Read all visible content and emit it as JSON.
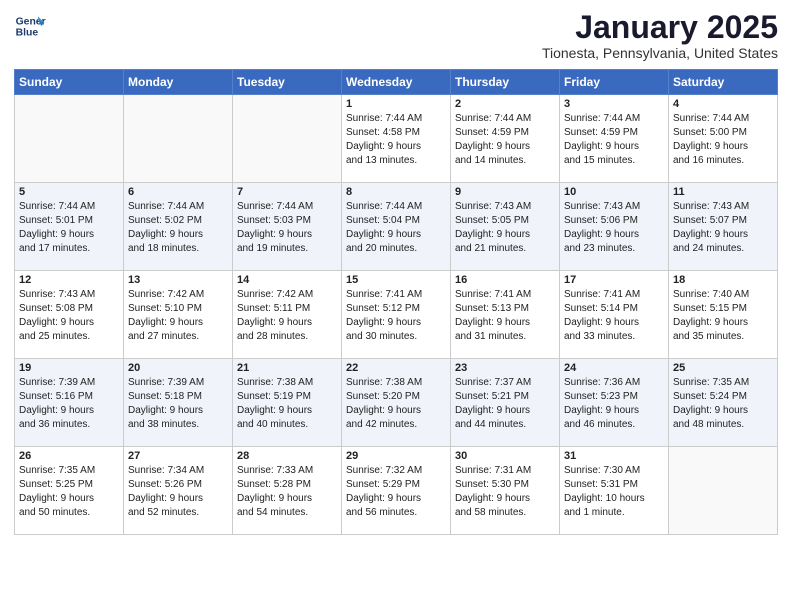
{
  "header": {
    "logo_line1": "General",
    "logo_line2": "Blue",
    "month": "January 2025",
    "location": "Tionesta, Pennsylvania, United States"
  },
  "days_of_week": [
    "Sunday",
    "Monday",
    "Tuesday",
    "Wednesday",
    "Thursday",
    "Friday",
    "Saturday"
  ],
  "weeks": [
    [
      {
        "day": "",
        "info": ""
      },
      {
        "day": "",
        "info": ""
      },
      {
        "day": "",
        "info": ""
      },
      {
        "day": "1",
        "info": "Sunrise: 7:44 AM\nSunset: 4:58 PM\nDaylight: 9 hours\nand 13 minutes."
      },
      {
        "day": "2",
        "info": "Sunrise: 7:44 AM\nSunset: 4:59 PM\nDaylight: 9 hours\nand 14 minutes."
      },
      {
        "day": "3",
        "info": "Sunrise: 7:44 AM\nSunset: 4:59 PM\nDaylight: 9 hours\nand 15 minutes."
      },
      {
        "day": "4",
        "info": "Sunrise: 7:44 AM\nSunset: 5:00 PM\nDaylight: 9 hours\nand 16 minutes."
      }
    ],
    [
      {
        "day": "5",
        "info": "Sunrise: 7:44 AM\nSunset: 5:01 PM\nDaylight: 9 hours\nand 17 minutes."
      },
      {
        "day": "6",
        "info": "Sunrise: 7:44 AM\nSunset: 5:02 PM\nDaylight: 9 hours\nand 18 minutes."
      },
      {
        "day": "7",
        "info": "Sunrise: 7:44 AM\nSunset: 5:03 PM\nDaylight: 9 hours\nand 19 minutes."
      },
      {
        "day": "8",
        "info": "Sunrise: 7:44 AM\nSunset: 5:04 PM\nDaylight: 9 hours\nand 20 minutes."
      },
      {
        "day": "9",
        "info": "Sunrise: 7:43 AM\nSunset: 5:05 PM\nDaylight: 9 hours\nand 21 minutes."
      },
      {
        "day": "10",
        "info": "Sunrise: 7:43 AM\nSunset: 5:06 PM\nDaylight: 9 hours\nand 23 minutes."
      },
      {
        "day": "11",
        "info": "Sunrise: 7:43 AM\nSunset: 5:07 PM\nDaylight: 9 hours\nand 24 minutes."
      }
    ],
    [
      {
        "day": "12",
        "info": "Sunrise: 7:43 AM\nSunset: 5:08 PM\nDaylight: 9 hours\nand 25 minutes."
      },
      {
        "day": "13",
        "info": "Sunrise: 7:42 AM\nSunset: 5:10 PM\nDaylight: 9 hours\nand 27 minutes."
      },
      {
        "day": "14",
        "info": "Sunrise: 7:42 AM\nSunset: 5:11 PM\nDaylight: 9 hours\nand 28 minutes."
      },
      {
        "day": "15",
        "info": "Sunrise: 7:41 AM\nSunset: 5:12 PM\nDaylight: 9 hours\nand 30 minutes."
      },
      {
        "day": "16",
        "info": "Sunrise: 7:41 AM\nSunset: 5:13 PM\nDaylight: 9 hours\nand 31 minutes."
      },
      {
        "day": "17",
        "info": "Sunrise: 7:41 AM\nSunset: 5:14 PM\nDaylight: 9 hours\nand 33 minutes."
      },
      {
        "day": "18",
        "info": "Sunrise: 7:40 AM\nSunset: 5:15 PM\nDaylight: 9 hours\nand 35 minutes."
      }
    ],
    [
      {
        "day": "19",
        "info": "Sunrise: 7:39 AM\nSunset: 5:16 PM\nDaylight: 9 hours\nand 36 minutes."
      },
      {
        "day": "20",
        "info": "Sunrise: 7:39 AM\nSunset: 5:18 PM\nDaylight: 9 hours\nand 38 minutes."
      },
      {
        "day": "21",
        "info": "Sunrise: 7:38 AM\nSunset: 5:19 PM\nDaylight: 9 hours\nand 40 minutes."
      },
      {
        "day": "22",
        "info": "Sunrise: 7:38 AM\nSunset: 5:20 PM\nDaylight: 9 hours\nand 42 minutes."
      },
      {
        "day": "23",
        "info": "Sunrise: 7:37 AM\nSunset: 5:21 PM\nDaylight: 9 hours\nand 44 minutes."
      },
      {
        "day": "24",
        "info": "Sunrise: 7:36 AM\nSunset: 5:23 PM\nDaylight: 9 hours\nand 46 minutes."
      },
      {
        "day": "25",
        "info": "Sunrise: 7:35 AM\nSunset: 5:24 PM\nDaylight: 9 hours\nand 48 minutes."
      }
    ],
    [
      {
        "day": "26",
        "info": "Sunrise: 7:35 AM\nSunset: 5:25 PM\nDaylight: 9 hours\nand 50 minutes."
      },
      {
        "day": "27",
        "info": "Sunrise: 7:34 AM\nSunset: 5:26 PM\nDaylight: 9 hours\nand 52 minutes."
      },
      {
        "day": "28",
        "info": "Sunrise: 7:33 AM\nSunset: 5:28 PM\nDaylight: 9 hours\nand 54 minutes."
      },
      {
        "day": "29",
        "info": "Sunrise: 7:32 AM\nSunset: 5:29 PM\nDaylight: 9 hours\nand 56 minutes."
      },
      {
        "day": "30",
        "info": "Sunrise: 7:31 AM\nSunset: 5:30 PM\nDaylight: 9 hours\nand 58 minutes."
      },
      {
        "day": "31",
        "info": "Sunrise: 7:30 AM\nSunset: 5:31 PM\nDaylight: 10 hours\nand 1 minute."
      },
      {
        "day": "",
        "info": ""
      }
    ]
  ]
}
